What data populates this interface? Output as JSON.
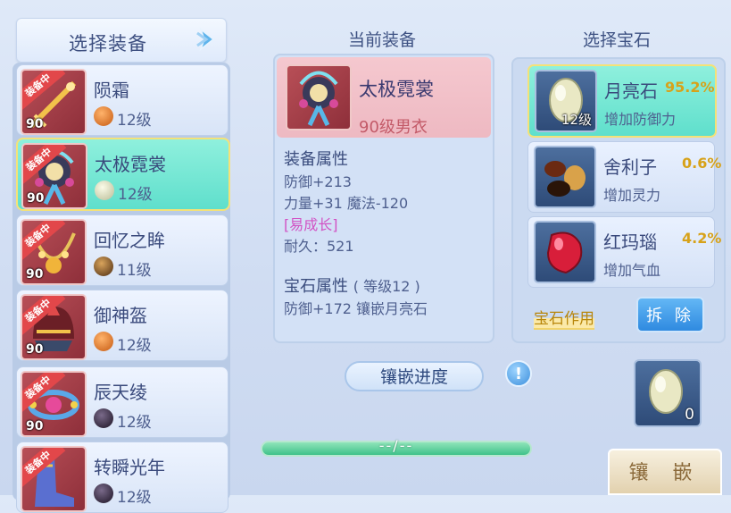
{
  "left": {
    "title": "选择装备",
    "items": [
      {
        "name": "陨霜",
        "level": "90",
        "stone_level": "12级",
        "badge": "装备中",
        "stone": "orange"
      },
      {
        "name": "太极霓裳",
        "level": "90",
        "stone_level": "12级",
        "badge": "装备中",
        "stone": "white"
      },
      {
        "name": "回忆之眸",
        "level": "90",
        "stone_level": "11级",
        "badge": "装备中",
        "stone": "brown"
      },
      {
        "name": "御神盔",
        "level": "90",
        "stone_level": "12级",
        "badge": "装备中",
        "stone": "orange"
      },
      {
        "name": "辰天绫",
        "level": "90",
        "stone_level": "12级",
        "badge": "装备中",
        "stone": "dark"
      },
      {
        "name": "转瞬光年",
        "level": "",
        "stone_level": "12级",
        "badge": "装备中",
        "stone": "dark"
      }
    ]
  },
  "middle": {
    "title": "当前装备",
    "name": "太极霓裳",
    "subtitle": "90级男衣",
    "attr_title": "装备属性",
    "attr_lines": [
      "防御+213",
      "力量+31 魔法-120",
      "[易成长]",
      "耐久：521"
    ],
    "gem_attr_title": "宝石属性",
    "gem_attr_level": "( 等级12 )",
    "gem_attr_line": "防御+172 镶嵌月亮石"
  },
  "right": {
    "title": "选择宝石",
    "gems": [
      {
        "name": "月亮石",
        "percent": "95.2%",
        "effect": "增加防御力",
        "level": "12级"
      },
      {
        "name": "舍利子",
        "percent": "0.6%",
        "effect": "增加灵力",
        "level": ""
      },
      {
        "name": "红玛瑙",
        "percent": "4.2%",
        "effect": "增加气血",
        "level": ""
      }
    ],
    "gem_effect_label": "宝石作用",
    "remove_label": "拆 除"
  },
  "bottom": {
    "progress_label": "镶嵌进度",
    "info_symbol": "!",
    "progress_text": "--/--",
    "slot_count": "0",
    "inlay_label": "镶 嵌"
  },
  "colors": {
    "accent": "#5fdfcc",
    "badge": "#e2474a",
    "percent": "#d7a21a"
  }
}
